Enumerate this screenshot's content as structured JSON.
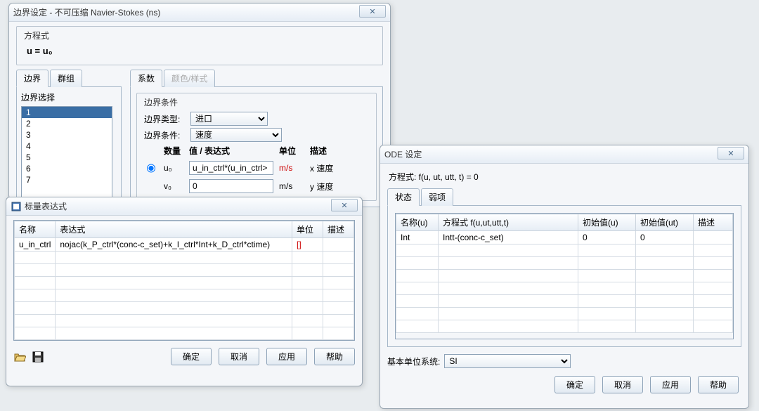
{
  "boundary": {
    "title": "边界设定 - 不可压缩 Navier-Stokes (ns)",
    "close": "✕",
    "equation_group_label": "方程式",
    "equation_html": "u = u₀",
    "sel_tabs": {
      "boundary": "边界",
      "group": "群组"
    },
    "sel_label": "边界选择",
    "list_items": [
      "1",
      "2",
      "3",
      "4",
      "5",
      "6",
      "7"
    ],
    "selected_index": 0,
    "coef_tabs": {
      "coef": "系数",
      "color": "颜色/样式"
    },
    "cond_group_label": "边界条件",
    "type_label": "边界类型:",
    "type_value": "进口",
    "cond_label": "边界条件:",
    "cond_value": "速度",
    "head_qty": "数量",
    "head_val": "值 / 表达式",
    "head_unit": "单位",
    "head_desc": "描述",
    "u0_sym": "u₀",
    "u0_val": "u_in_ctrl*(u_in_ctrl>",
    "u0_unit": "m/s",
    "u0_desc": "x 速度",
    "v0_sym": "v₀",
    "v0_val": "0",
    "v0_unit": "m/s",
    "v0_desc": "y 速度"
  },
  "scalar": {
    "title": "标量表达式",
    "close": "✕",
    "cols": {
      "name": "名称",
      "expr": "表达式",
      "unit": "单位",
      "desc": "描述"
    },
    "rows": [
      {
        "name": "u_in_ctrl",
        "expr": "nojac(k_P_ctrl*(conc-c_set)+k_I_ctrl*Int+k_D_ctrl*ctime)",
        "unit": "[]",
        "desc": ""
      }
    ],
    "buttons": {
      "ok": "确定",
      "cancel": "取消",
      "apply": "应用",
      "help": "帮助"
    }
  },
  "ode": {
    "title": "ODE 设定",
    "close": "✕",
    "eq_label": "方程式: f(u, ut, utt, t) = 0",
    "tabs": {
      "state": "状态",
      "weak": "弱项"
    },
    "cols": {
      "name": "名称(u)",
      "eq": "方程式 f(u,ut,utt,t)",
      "init_u": "初始值(u)",
      "init_ut": "初始值(ut)",
      "desc": "描述"
    },
    "rows": [
      {
        "name": "Int",
        "eq": "Intt-(conc-c_set)",
        "init_u": "0",
        "init_ut": "0",
        "desc": ""
      }
    ],
    "basis_label": "基本单位系统:",
    "basis_value": "SI",
    "buttons": {
      "ok": "确定",
      "cancel": "取消",
      "apply": "应用",
      "help": "帮助"
    }
  }
}
